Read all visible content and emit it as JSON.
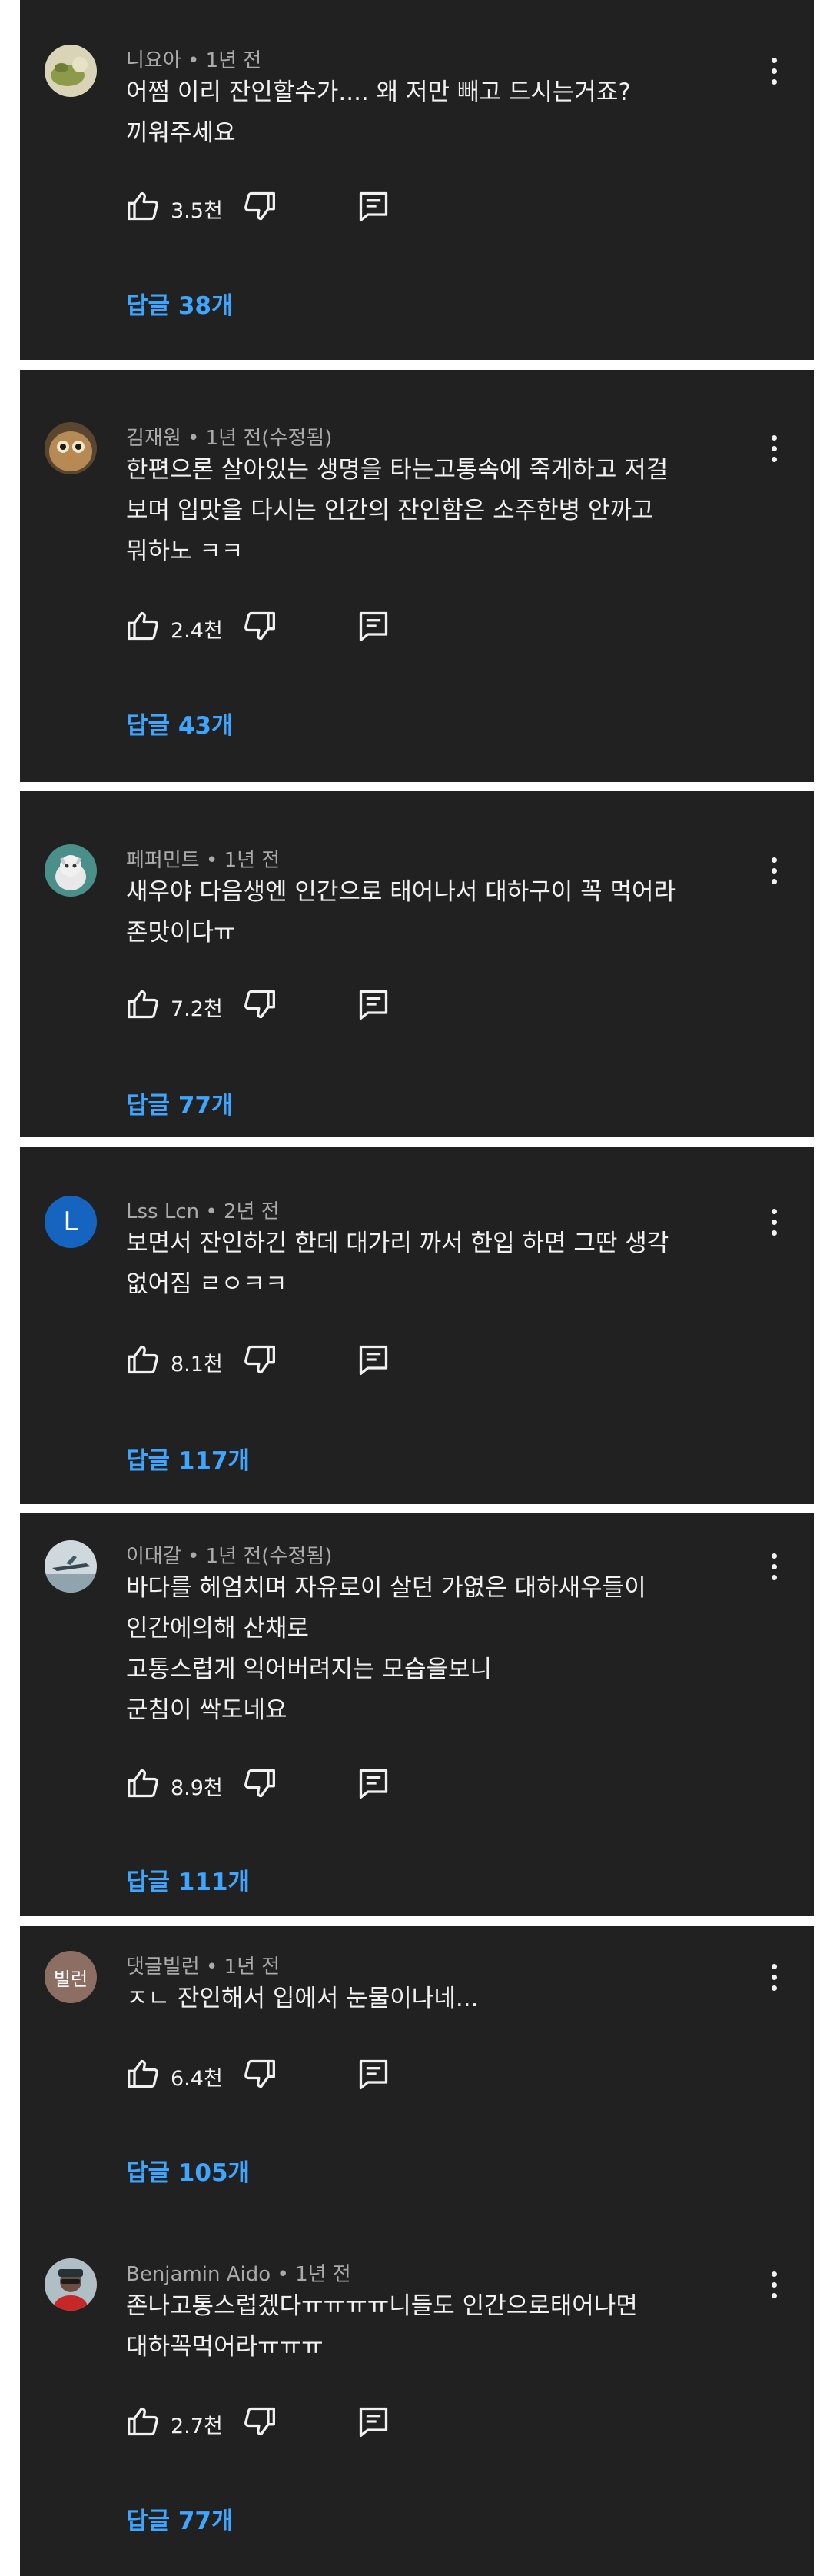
{
  "comments": [
    {
      "author": "니요아",
      "time": "1년 전",
      "lines": [
        "어쩜 이리 잔인할수가.... 왜 저만 빼고 드시는거죠?",
        "끼워주세요"
      ],
      "likes": "3.5천",
      "replies": "답글 38개",
      "avatar": "nature-photo"
    },
    {
      "author": "김재원",
      "time": "1년 전(수정됨)",
      "lines": [
        "한편으론 살아있는 생명을 타는고통속에 죽게하고 저걸",
        "보며 입맛을 다시는 인간의 잔인함은 소주한병 안까고",
        "뭐하노 ㅋㅋ"
      ],
      "likes": "2.4천",
      "replies": "답글 43개",
      "avatar": "owl-photo"
    },
    {
      "author": "페퍼민트",
      "time": "1년 전",
      "lines": [
        "새우야 다음생엔 인간으로 태어나서 대하구이 꼭 먹어라",
        "존맛이다ㅠ"
      ],
      "likes": "7.2천",
      "replies": "답글 77개",
      "avatar": "cat-photo"
    },
    {
      "author": "Lss Lcn",
      "time": "2년 전",
      "lines": [
        "보면서 잔인하긴 한데 대가리 까서 한입 하면 그딴 생각",
        "없어짐 ㄹㅇㅋㅋ"
      ],
      "likes": "8.1천",
      "replies": "답글 117개",
      "avatar_letter": "L",
      "avatar_color": "#1565c0"
    },
    {
      "author": "이대갈",
      "time": "1년 전(수정됨)",
      "lines": [
        "바다를 헤엄치며 자유로이 살던 가엾은 대하새우들이",
        "인간에의해 산채로",
        "고통스럽게 익어버려지는 모습을보니",
        "군침이 싹도네요"
      ],
      "likes": "8.9천",
      "replies": "답글 111개",
      "avatar": "aircraft-photo"
    },
    {
      "author": "댓글빌런",
      "time": "1년 전",
      "lines": [
        "ㅈㄴ 잔인해서 입에서 눈물이나네..."
      ],
      "likes": "6.4천",
      "replies": "답글 105개",
      "avatar_text": "빌런",
      "avatar_color": "#8d6e63"
    },
    {
      "author": "Benjamin Aido",
      "time": "1년 전",
      "lines": [
        "존나고통스럽겠다ㅠㅠㅠㅠ니들도 인간으로태어나면",
        "대하꼭먹어라ㅠㅠㅠ"
      ],
      "likes": "2.7천",
      "replies": "답글 77개",
      "avatar": "person-photo"
    }
  ],
  "separator": "•",
  "colors": {
    "card_bg": "#212121",
    "text": "#f1f1f1",
    "meta": "#aaaaaa",
    "link": "#3ea6ff",
    "page_bg": "#ffffff"
  }
}
